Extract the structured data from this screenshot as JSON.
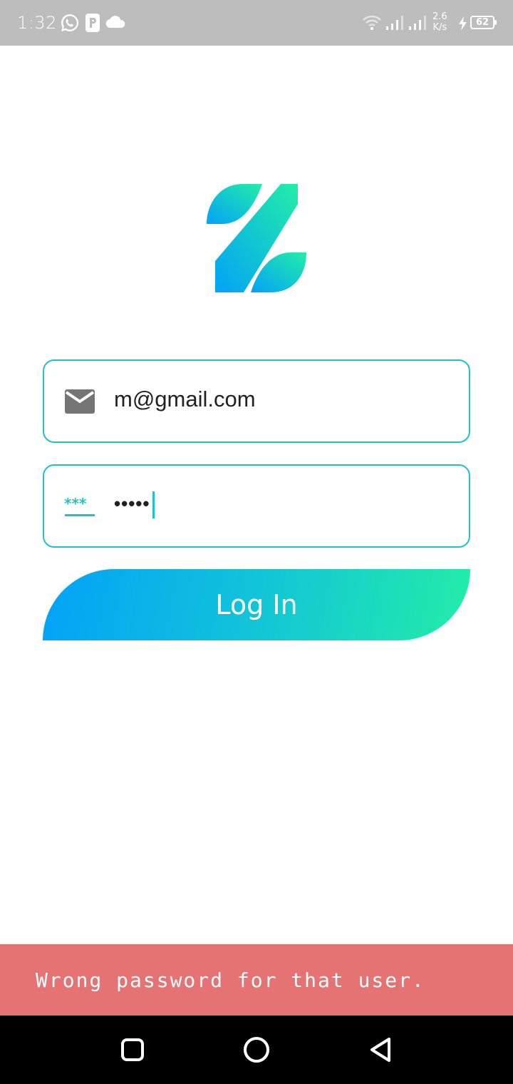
{
  "status_bar": {
    "time": "1:32",
    "network_speed_value": "2.6",
    "network_speed_unit": "K/s",
    "battery_level": "62",
    "icons": [
      "whatsapp-icon",
      "parking-icon",
      "cloud-icon",
      "wifi-icon",
      "signal-icon",
      "signal-icon",
      "charging-icon",
      "battery-icon"
    ]
  },
  "login_form": {
    "email": {
      "value": "m@gmail.com",
      "icon": "mail-icon"
    },
    "password": {
      "value": "•••••",
      "icon": "password-icon"
    },
    "login_button_label": "Log In"
  },
  "snackbar": {
    "message": "Wrong password for that user."
  },
  "nav_bar": {
    "icons": [
      "recents-icon",
      "home-icon",
      "back-icon"
    ]
  },
  "colors": {
    "accent": "#1fc2cc",
    "gradient_start": "#03a2f7",
    "gradient_end": "#22eea7",
    "error": "#e57373",
    "status_bar": "#bdbdbd"
  }
}
